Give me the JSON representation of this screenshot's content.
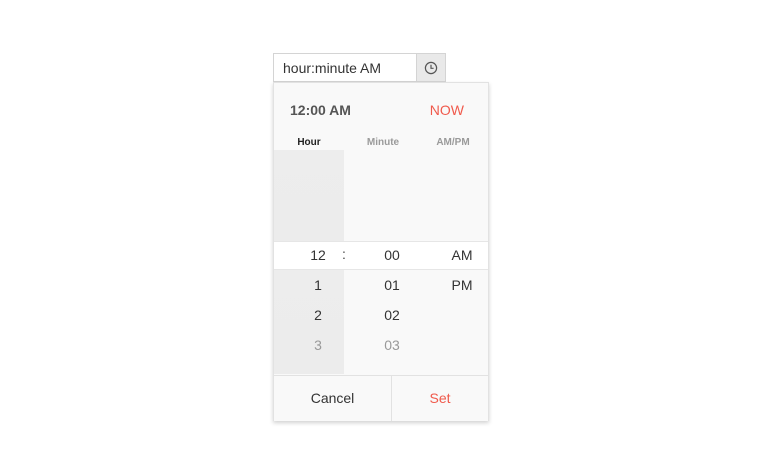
{
  "input": {
    "value": "hour:minute AM",
    "icon": "clock-icon"
  },
  "picker": {
    "header_time": "12:00 AM",
    "now_label": "NOW",
    "columns": {
      "hour": "Hour",
      "minute": "Minute",
      "ampm": "AM/PM"
    },
    "selected": {
      "hour": "12",
      "separator": ":",
      "minute": "00",
      "ampm": "AM"
    },
    "hours_below": [
      "1",
      "2",
      "3"
    ],
    "minutes_below": [
      "01",
      "02",
      "03"
    ],
    "ampm_below": [
      "PM"
    ],
    "cancel_label": "Cancel",
    "set_label": "Set"
  },
  "colors": {
    "accent": "#f05a4c",
    "hour_column_bg": "#ededed",
    "popup_bg": "#f9f9f9"
  }
}
